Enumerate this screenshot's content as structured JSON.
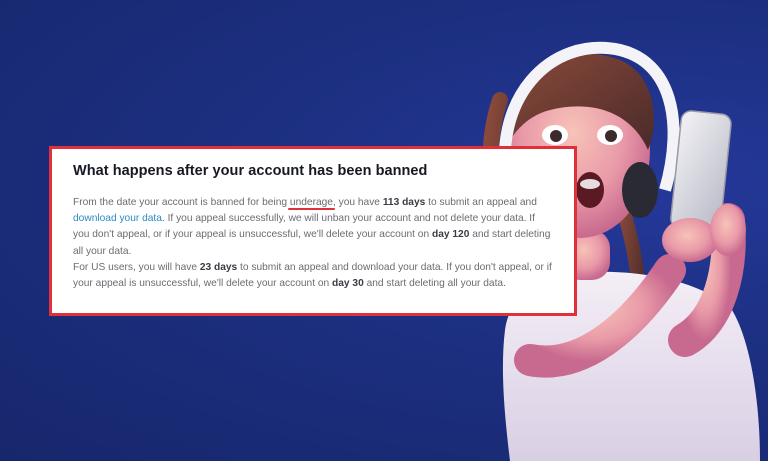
{
  "card": {
    "title": "What happens after your account has been banned",
    "p1_a": "From the date your account is banned for being ",
    "p1_underage": "underage",
    "p1_b": ", you have ",
    "p1_days": "113 days",
    "p1_c": " to submit an appeal and ",
    "p1_link": "download your data",
    "p1_d": ". If you appeal successfully, we will unban your account and not delete your data. If you don't appeal, or if your appeal is unsuccessful, we'll delete your account on ",
    "p1_day": "day 120",
    "p1_e": " and start deleting all your data.",
    "p2_a": "For US users, you will have ",
    "p2_days": "23 days",
    "p2_b": " to submit an appeal and download your data. If you don't appeal, or if your appeal is unsuccessful, we'll delete your account on ",
    "p2_day": "day 30",
    "p2_c": " and start deleting all your data."
  },
  "colors": {
    "background": "#1b2f7c",
    "card_border": "#e0313b",
    "link": "#2b8cc4",
    "underline": "#e0313b"
  },
  "image": {
    "subject": "child-with-headphones-holding-phone"
  }
}
